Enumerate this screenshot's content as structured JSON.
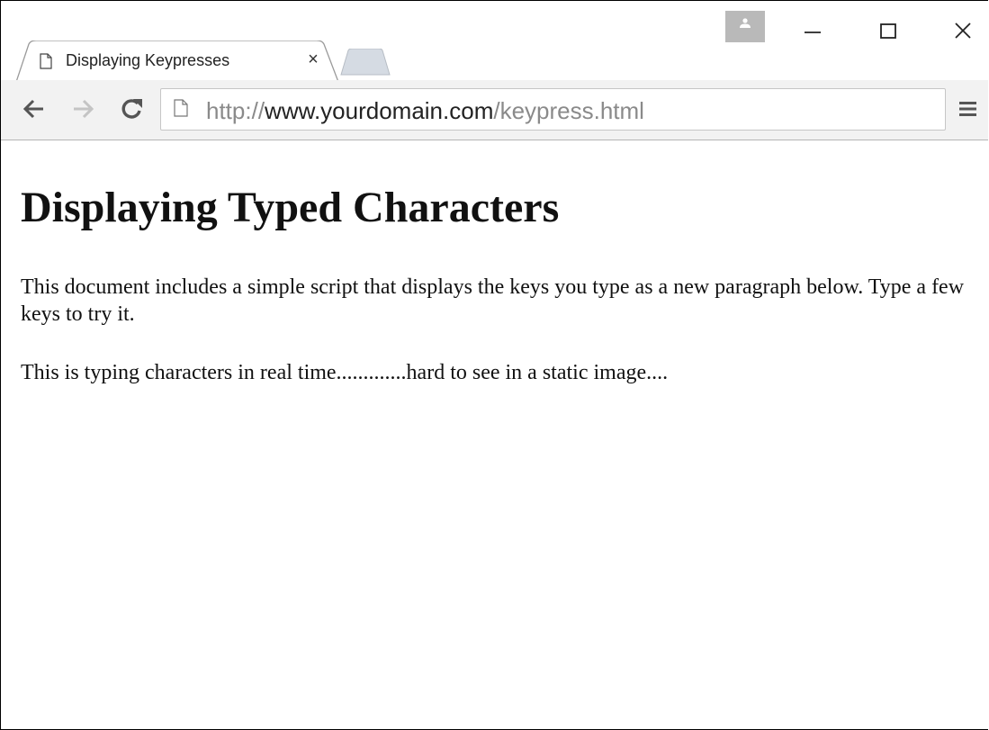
{
  "tab": {
    "title": "Displaying Keypresses",
    "close": "×"
  },
  "address_bar": {
    "scheme": "http://",
    "host": "www.yourdomain.com",
    "path": "/keypress.html"
  },
  "page": {
    "heading": "Displaying Typed Characters",
    "paragraph": "This document includes a simple script that displays the keys you type as a new paragraph below. Type a few keys to try it.",
    "typed_output": "This is typing characters in real time.............hard to see in a static image...."
  },
  "icons": {
    "back": "back-arrow-icon",
    "forward": "forward-arrow-icon",
    "reload": "reload-icon",
    "page": "page-icon",
    "menu": "hamburger-menu-icon",
    "minimize": "minimize-icon",
    "maximize": "maximize-icon",
    "close": "close-icon",
    "profile": "user-icon"
  },
  "colors": {
    "toolbar_bg": "#f2f2f2",
    "profile_bg": "#b9b9b9",
    "url_gray": "#8a8a8a",
    "text": "#111111"
  }
}
